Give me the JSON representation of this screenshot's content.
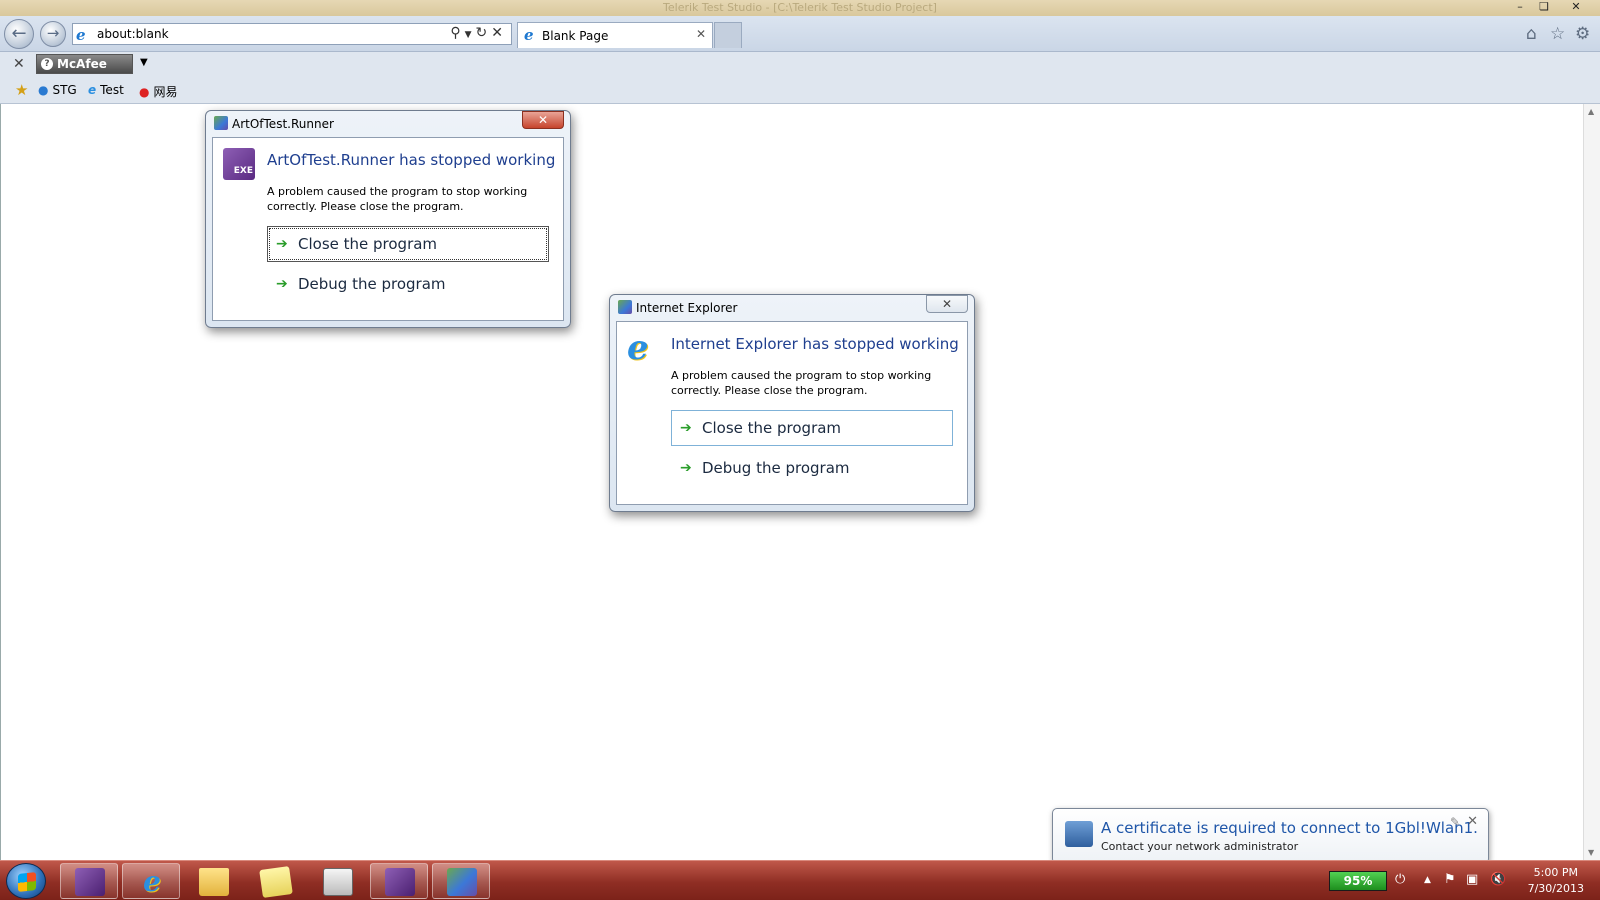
{
  "browser": {
    "window_title": "Telerik Test Studio - [C:\\Telerik Test Studio Project]",
    "address_url": "about:blank",
    "tab_label": "Blank Page",
    "toolbar": {
      "mcafee_label": "McAfee"
    },
    "favorites": [
      {
        "label": "STG"
      },
      {
        "label": "Test"
      },
      {
        "label": "网易"
      }
    ]
  },
  "dialogs": {
    "runner": {
      "title": "ArtOfTest.Runner",
      "heading": "ArtOfTest.Runner has stopped working",
      "message_line1": "A problem caused the program to stop working",
      "message_line2": "correctly. Please close the program.",
      "option_close": "Close the program",
      "option_debug": "Debug the program",
      "icon_text": "EXE"
    },
    "ie": {
      "title": "Internet Explorer",
      "heading": "Internet Explorer has stopped working",
      "message_line1": "A problem caused the program to stop working",
      "message_line2": "correctly. Please close the program.",
      "option_close": "Close the program",
      "option_debug": "Debug the program"
    }
  },
  "notification": {
    "title": "A certificate is required to connect to 1Gbl!Wlan1.",
    "subtitle": "Contact your network administrator"
  },
  "taskbar": {
    "battery_percent": "95%",
    "clock_time": "5:00 PM",
    "clock_date": "7/30/2013"
  }
}
